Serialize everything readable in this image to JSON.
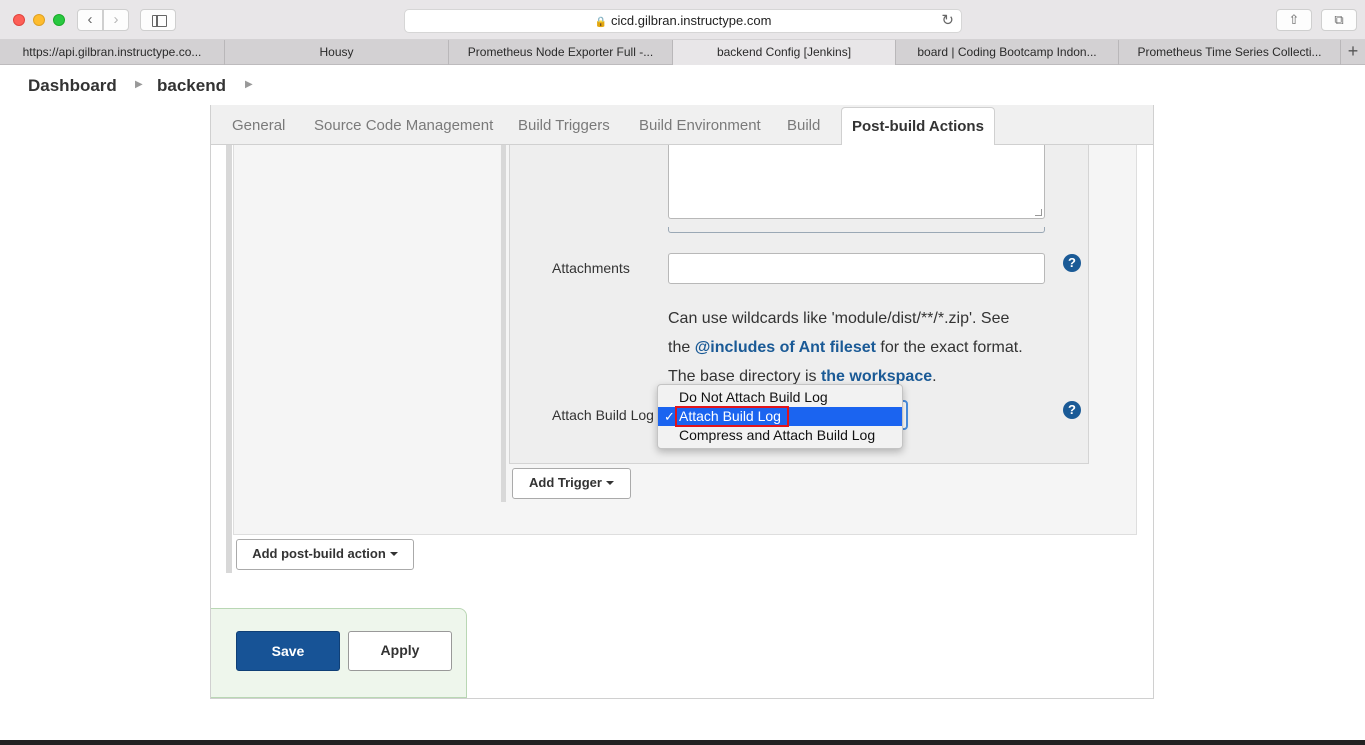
{
  "browser": {
    "url": "cicd.gilbran.instructype.com",
    "tabs": [
      {
        "label": "https://api.gilbran.instructype.co..."
      },
      {
        "label": "Housy"
      },
      {
        "label": "Prometheus Node Exporter Full -..."
      },
      {
        "label": "backend Config [Jenkins]"
      },
      {
        "label": "board | Coding Bootcamp Indon..."
      },
      {
        "label": "Prometheus Time Series Collecti..."
      }
    ]
  },
  "breadcrumbs": [
    "Dashboard",
    "backend"
  ],
  "config_tabs": [
    "General",
    "Source Code Management",
    "Build Triggers",
    "Build Environment",
    "Build",
    "Post-build Actions"
  ],
  "form": {
    "attachments_label": "Attachments",
    "attachments_value": "",
    "help_line1": "Can use wildcards like 'module/dist/**/*.zip'. See",
    "help_line2_pre": "the ",
    "help_link1": "@includes of Ant fileset",
    "help_line2_post": " for the exact format.",
    "help_line3_pre": "The base directory is ",
    "help_link2": "the workspace",
    "help_line3_post": ".",
    "attach_log_label": "Attach Build Log",
    "attach_log_options": [
      "Do Not Attach Build Log",
      "Attach Build Log",
      "Compress and Attach Build Log"
    ],
    "attach_log_selected": "Attach Build Log",
    "check_mark": "✓",
    "help_glyph": "?"
  },
  "buttons": {
    "add_trigger": "Add Trigger",
    "add_post_build": "Add post-build action",
    "save": "Save",
    "apply": "Apply"
  },
  "colors": {
    "jenkins_blue": "#175396",
    "selection_blue": "#1b64f0",
    "highlight_red": "#e2141b"
  }
}
